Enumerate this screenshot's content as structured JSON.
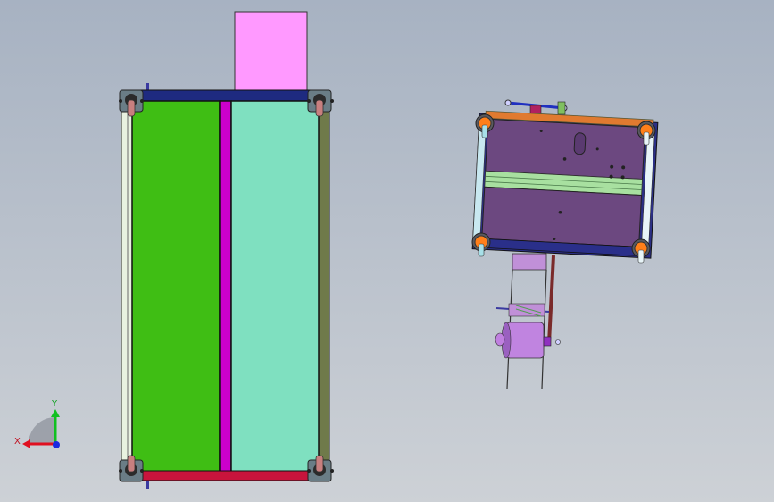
{
  "viewport": {
    "background_top": "#a7b2c2",
    "background_bottom": "#cdd1d6"
  },
  "left_assembly": {
    "name": "frame-assembly-top-view",
    "colors": {
      "pink_block": "#ff99ff",
      "green_panel": "#3fbe14",
      "teal_panel": "#7fe0c0",
      "magenta_strip": "#cc00cc",
      "navy_bar": "#1e2a80",
      "red_bar": "#c8143c",
      "olive_rail": "#6f7a4a",
      "pale_rail": "#e8f2e0",
      "corner_mount": "#6a7d86",
      "corner_cap": "#c87f7f"
    }
  },
  "right_assembly": {
    "name": "rotated-mechanism-assembly",
    "colors": {
      "plate": "#6c4880",
      "plate_edge": "#2b2f86",
      "corner_orange": "#ff7f1a",
      "rail_green": "#a8e0a0",
      "roller": "#c084e0",
      "arm": "#5c2a2a"
    }
  },
  "triad": {
    "x_label": "X",
    "y_label": "Y",
    "x_color": "#e01020",
    "y_color": "#10c020",
    "z_color": "#1a2ae0"
  }
}
